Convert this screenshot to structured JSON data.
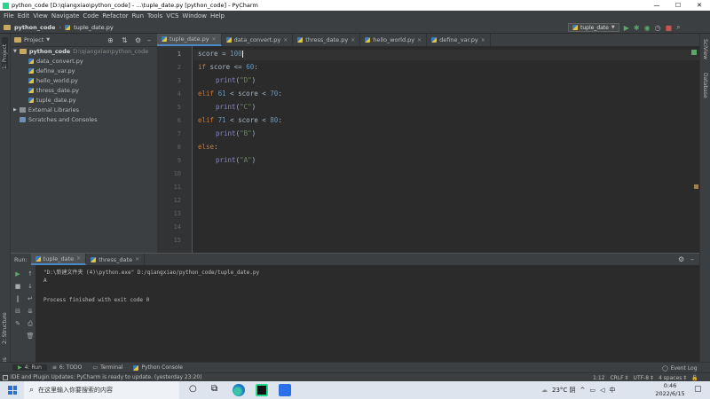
{
  "window": {
    "title": "python_code [D:\\qiangxiao\\python_code] - ...\\tuple_date.py [python_code] - PyCharm",
    "minimize": "—",
    "maximize": "☐",
    "close": "✕"
  },
  "menu": [
    "File",
    "Edit",
    "View",
    "Navigate",
    "Code",
    "Refactor",
    "Run",
    "Tools",
    "VCS",
    "Window",
    "Help"
  ],
  "breadcrumb": {
    "project": "python_code",
    "file": "tuple_date.py"
  },
  "run_config": "tuple_date",
  "project_panel": {
    "title": "Project",
    "root": "python_code",
    "root_path": "D:\\qiangxiao\\python_code",
    "files": [
      "data_convert.py",
      "define_var.py",
      "hello_world.py",
      "thress_date.py",
      "tuple_date.py"
    ],
    "external": "External Libraries",
    "scratches": "Scratches and Consoles"
  },
  "editor_tabs": [
    "tuple_date.py",
    "data_convert.py",
    "thress_date.py",
    "hello_world.py",
    "define_var.py"
  ],
  "active_tab_index": 0,
  "line_numbers": [
    "1",
    "2",
    "3",
    "4",
    "5",
    "6",
    "7",
    "8",
    "9",
    "10",
    "11",
    "12",
    "13",
    "14",
    "15"
  ],
  "code": {
    "l1": [
      "score",
      " = ",
      "100"
    ],
    "l2": [
      "if",
      " score <= ",
      "60",
      ":"
    ],
    "l3": [
      "print",
      "(",
      "\"D\"",
      ")"
    ],
    "l4": [
      "elif",
      " ",
      "61",
      " < score < ",
      "70",
      ":"
    ],
    "l5": [
      "print",
      "(",
      "\"C\"",
      ")"
    ],
    "l6": [
      "elif",
      " ",
      "71",
      " < score < ",
      "80",
      ":"
    ],
    "l7": [
      "print",
      "(",
      "\"B\"",
      ")"
    ],
    "l8": [
      "else",
      ":"
    ],
    "l9": [
      "print",
      "(",
      "\"A\"",
      ")"
    ]
  },
  "run_panel": {
    "label": "Run:",
    "tabs": [
      "tuple_date",
      "thress_date"
    ],
    "output": [
      "\"D:\\新建文件夹 (4)\\python.exe\" D:/qiangxiao/python_code/tuple_date.py",
      "A",
      "",
      "Process finished with exit code 0"
    ]
  },
  "left_strip": [
    "1: Project",
    "2: Structure",
    "2: Favorites"
  ],
  "right_strip": [
    "SciView",
    "Database"
  ],
  "bottom_tabs": [
    "4: Run",
    "6: TODO",
    "Terminal",
    "Python Console"
  ],
  "event_log": "Event Log",
  "status": {
    "message": "IDE and Plugin Updates: PyCharm is ready to update. (yesterday 23:20)",
    "position": "1:12",
    "line_sep": "CRLF ‡",
    "encoding": "UTF-8 ‡",
    "indent": "4 spaces ‡"
  },
  "taskbar": {
    "search_placeholder": "在这里输入你要搜索的内容",
    "weather": "23°C 阴",
    "lang": "中",
    "time": "0:46",
    "date": "2022/6/15"
  },
  "colors": {
    "bg": "#2b2b2b",
    "panel": "#3c3f41",
    "keyword": "#cc7832",
    "number": "#6897bb",
    "string": "#6a8759",
    "accent": "#4a88c7"
  }
}
